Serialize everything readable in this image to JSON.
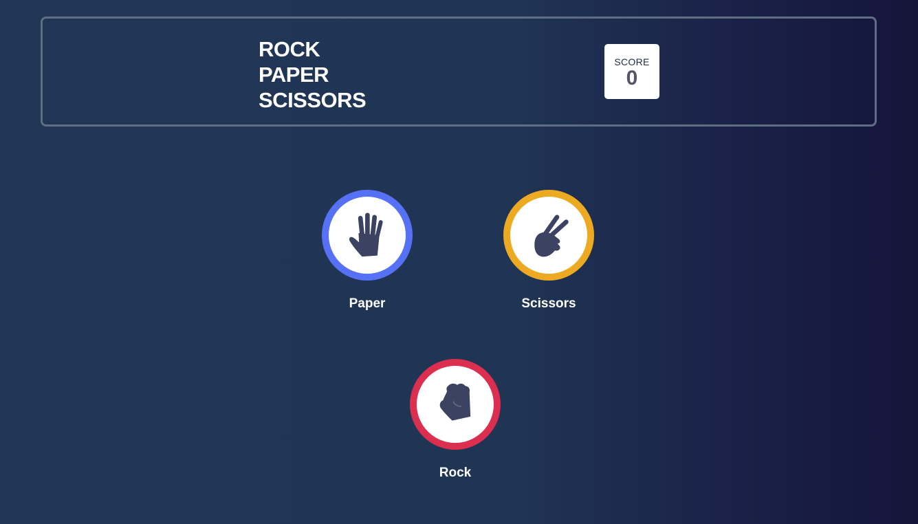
{
  "header": {
    "title_lines": [
      "ROCK",
      "PAPER",
      "SCISSORS"
    ],
    "score_label": "SCORE",
    "score_value": "0"
  },
  "choices": [
    {
      "id": "paper",
      "label": "Paper",
      "ring_color": "#5671f5",
      "icon": "paper-hand-icon"
    },
    {
      "id": "scissors",
      "label": "Scissors",
      "ring_color": "#eca922",
      "icon": "scissors-hand-icon"
    },
    {
      "id": "rock",
      "label": "Rock",
      "ring_color": "#dc2e4e",
      "icon": "rock-fist-icon"
    }
  ],
  "colors": {
    "icon_fill": "#3b4262",
    "header_border": "#606e85",
    "background_left": "#213655",
    "background_right": "#141539"
  }
}
